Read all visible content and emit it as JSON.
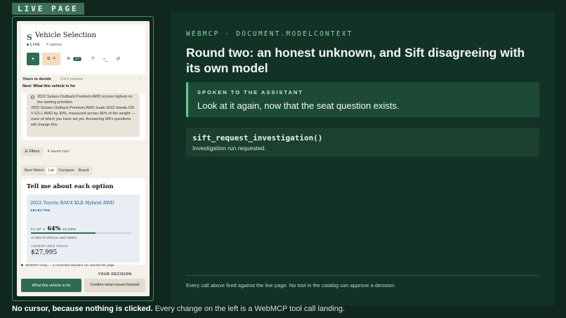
{
  "live_tag": "LIVE PAGE",
  "app": {
    "title": "Vehicle Selection",
    "live_label": "LIVE",
    "options_count": "4 options",
    "toolbar": {
      "add": "+",
      "compare_count": "4",
      "in_label": "In",
      "in_count": "17"
    },
    "decide": {
      "label": "Yours to decide",
      "covered": "0 of 5 covered",
      "next_prefix": "Next:",
      "next_value": "What this vehicle is for"
    },
    "scenario": {
      "line1": "2022 Subaru Outback Premium AWD scores highest on the starting priorities.",
      "line2": "2022 Subaru Outback Premium AWD leads 2022 Honda CR-V EX-L AWD by 30%, measured across 96% of the weight — none of which you have set yet. Answering Sift's questions will change this."
    },
    "filters": {
      "button": "Filters",
      "saved": "4 saved cars"
    },
    "views": [
      "Best Match",
      "List",
      "Compare",
      "Board"
    ],
    "active_view": "List",
    "tell": {
      "heading": "Tell me about each option",
      "car_name": "2022 Toyota RAV4 XLE Hybrid AWD",
      "selected": "SELECTED",
      "rank": "#3 OF 4",
      "pct": "64%",
      "score_label": "SCORE",
      "score_fraction": 0.64,
      "coverage": "on 96% of what you said matters",
      "price_label": "ADVERTISED PRICE",
      "price": "$27,995"
    },
    "status": "WebMCP ready — a connected assistant can operate this page.",
    "your_decision": "YOUR DECISION",
    "btn_what": "What this vehicle is for",
    "btn_confirm": "Confirm what moves forward"
  },
  "panel": {
    "eyebrow": "WEBMCP · DOCUMENT.MODELCONTEXT",
    "title": "Round two: an honest unknown, and Sift disagreeing with its own model",
    "spoken_label": "SPOKEN TO THE ASSISTANT",
    "spoken_text": "Look at it again, now that the seat question exists.",
    "call_fn": "sift_request_investigation()",
    "call_result": "Investigation run requested.",
    "footer": "Every call above fired against the live page. No tool in the catalog can approve a decision."
  },
  "caption": {
    "bold": "No cursor, because nothing is clicked.",
    "rest": " Every change on the left is a WebMCP tool call landing."
  },
  "colors": {
    "accent": "#2f6b52",
    "panel_bg": "#133226",
    "page_bg": "#10271d"
  }
}
